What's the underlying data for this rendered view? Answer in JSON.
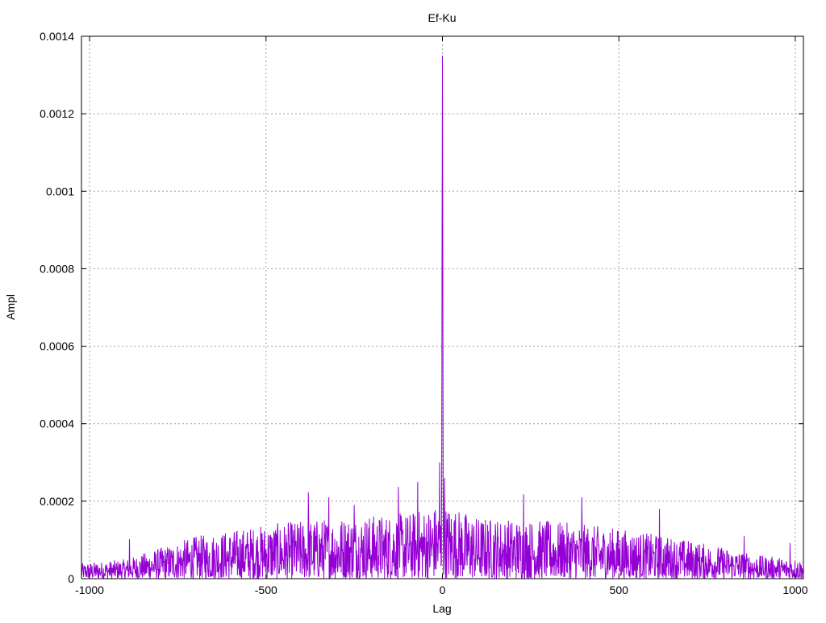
{
  "chart_data": {
    "type": "line",
    "title": "Ef-Ku",
    "xlabel": "Lag",
    "ylabel": "Ampl",
    "xlim": [
      -1023,
      1023
    ],
    "ylim": [
      0,
      0.0014
    ],
    "xticks": [
      -1000,
      -500,
      0,
      500,
      1000
    ],
    "xtick_labels": [
      "-1000",
      "-500",
      "0",
      "500",
      "1000"
    ],
    "yticks": [
      0,
      0.0002,
      0.0004,
      0.0006,
      0.0008,
      0.001,
      0.0012,
      0.0014
    ],
    "ytick_labels": [
      "0",
      "0.0002",
      "0.0004",
      "0.0006",
      "0.0008",
      "0.001",
      "0.0012",
      "0.0014"
    ],
    "grid": true,
    "series_color": "#9400d3",
    "series": [
      {
        "name": "Ef-Ku",
        "description_of_noise_envelope_lag": [
          -1023,
          -900,
          -700,
          -500,
          -300,
          -100,
          -20,
          20,
          100,
          300,
          500,
          700,
          900,
          1023
        ],
        "noise_envelope_max": [
          4e-05,
          5e-05,
          0.00011,
          0.00014,
          0.00016,
          0.00017,
          0.00019,
          0.00019,
          0.00016,
          0.00015,
          0.00013,
          0.0001,
          6e-05,
          5e-05
        ],
        "peaks": [
          {
            "lag": 0,
            "value": 0.00135
          },
          {
            "lag": -1,
            "value": 0.00089
          },
          {
            "lag": 1,
            "value": 0.00084
          },
          {
            "lag": -2,
            "value": 0.00029
          },
          {
            "lag": 2,
            "value": 0.00028
          },
          {
            "lag": -8,
            "value": 0.0003
          },
          {
            "lag": 6,
            "value": 0.00026
          },
          {
            "lag": -887,
            "value": 0.000102
          },
          {
            "lag": -380,
            "value": 0.000223
          },
          {
            "lag": -322,
            "value": 0.00021
          },
          {
            "lag": -250,
            "value": 0.00019
          },
          {
            "lag": -125,
            "value": 0.000237
          },
          {
            "lag": -70,
            "value": 0.00025
          },
          {
            "lag": 230,
            "value": 0.000218
          },
          {
            "lag": 395,
            "value": 0.00021
          },
          {
            "lag": 615,
            "value": 0.00018
          },
          {
            "lag": 855,
            "value": 0.00011
          },
          {
            "lag": 985,
            "value": 9.2e-05
          }
        ]
      }
    ]
  }
}
